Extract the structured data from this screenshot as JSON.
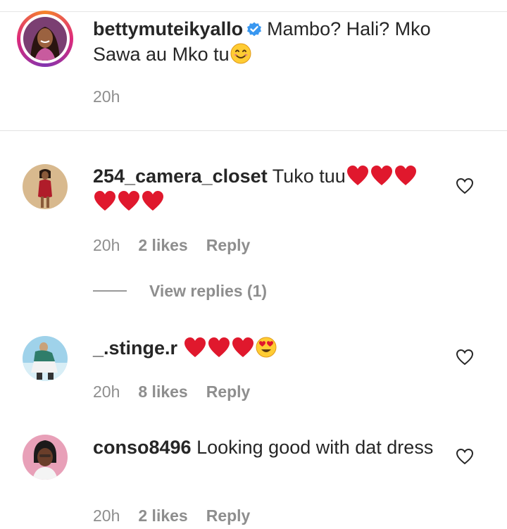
{
  "caption": {
    "username": "bettymuteikyallo",
    "verified": true,
    "text": "Mambo? Hali? Mko Sawa au Mko tu",
    "emoji": "smiling-face-icon",
    "time": "20h"
  },
  "comments": [
    {
      "username": "254_camera_closet",
      "text": "Tuko tuu",
      "emojis": [
        "red-heart",
        "red-heart",
        "red-heart",
        "red-heart",
        "red-heart",
        "red-heart"
      ],
      "time": "20h",
      "likes": "2 likes",
      "reply": "Reply",
      "view_replies": "View replies (1)"
    },
    {
      "username": "_.stinge.r",
      "text": "",
      "emojis": [
        "red-heart",
        "red-heart",
        "red-heart",
        "heart-eyes"
      ],
      "time": "20h",
      "likes": "8 likes",
      "reply": "Reply"
    },
    {
      "username": "conso8496",
      "text": "Looking good with dat dress",
      "emojis": [],
      "time": "20h",
      "likes": "2 likes",
      "reply": "Reply"
    }
  ],
  "colors": {
    "text": "#262626",
    "meta": "#8e8e8e",
    "verified": "#3897f0",
    "heart": "#e0182d"
  }
}
